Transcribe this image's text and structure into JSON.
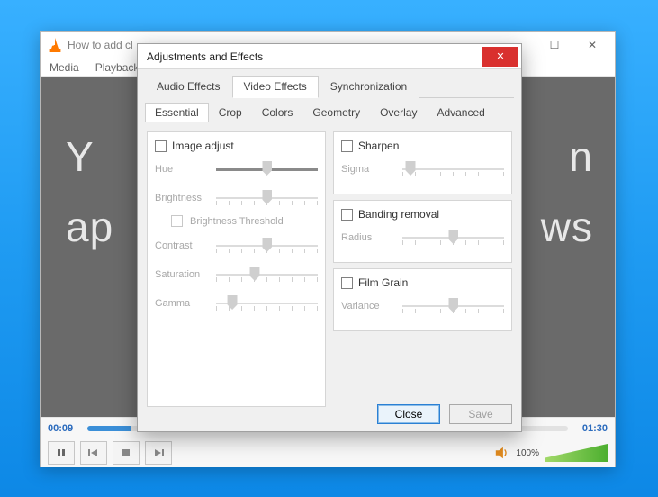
{
  "vlc": {
    "title": "How to add cl",
    "menu": {
      "media": "Media",
      "playback": "Playback"
    },
    "video_text_line1": "Y",
    "video_text_line2": "ap",
    "video_text_right1": "n",
    "video_text_right2": "ws",
    "time_current": "00:09",
    "time_total": "01:30",
    "progress_pct": 9,
    "volume_pct_label": "100%"
  },
  "window_controls": {
    "minimize": "—",
    "maximize": "☐",
    "close": "✕"
  },
  "dialog": {
    "title": "Adjustments and Effects",
    "close_btn": "✕",
    "tabs": {
      "audio": "Audio Effects",
      "video": "Video Effects",
      "sync": "Synchronization"
    },
    "subtabs": {
      "essential": "Essential",
      "crop": "Crop",
      "colors": "Colors",
      "geometry": "Geometry",
      "overlay": "Overlay",
      "advanced": "Advanced"
    },
    "image_adjust": {
      "checkbox_label": "Image adjust",
      "hue": "Hue",
      "brightness": "Brightness",
      "brightness_threshold": "Brightness Threshold",
      "contrast": "Contrast",
      "saturation": "Saturation",
      "gamma": "Gamma"
    },
    "sharpen": {
      "checkbox_label": "Sharpen",
      "sigma": "Sigma"
    },
    "banding": {
      "checkbox_label": "Banding removal",
      "radius": "Radius"
    },
    "film_grain": {
      "checkbox_label": "Film Grain",
      "variance": "Variance"
    },
    "buttons": {
      "close": "Close",
      "save": "Save"
    }
  },
  "slider_positions": {
    "hue": 50,
    "brightness": 50,
    "contrast": 50,
    "saturation": 38,
    "gamma": 16,
    "sigma": 8,
    "radius": 50,
    "variance": 50
  }
}
